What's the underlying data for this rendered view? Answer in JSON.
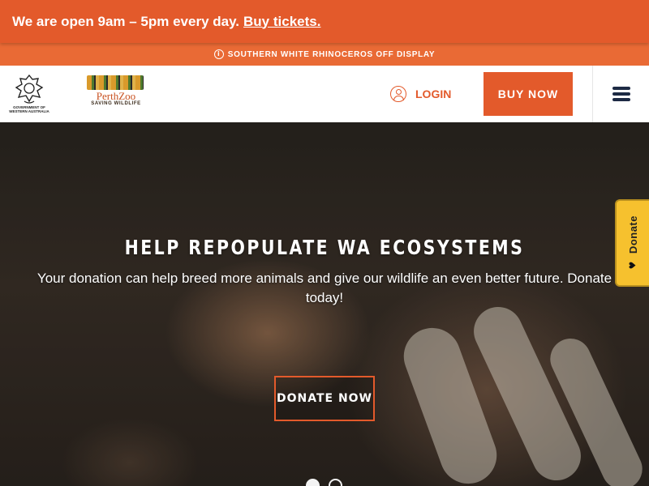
{
  "announcement": {
    "message": "We are open 9am – 5pm every day.",
    "link_text": "Buy tickets."
  },
  "alert": {
    "icon": "info-icon",
    "text": "SOUTHERN WHITE RHINOCEROS OFF DISPLAY"
  },
  "header": {
    "gov_logo_text": "GOVERNMENT OF WESTERN AUSTRALIA",
    "zoo_name": "PerthZoo",
    "zoo_tagline": "SAVING WILDLIFE",
    "login_label": "LOGIN",
    "buy_now_label": "BUY NOW",
    "menu_icon": "hamburger-menu-icon"
  },
  "hero": {
    "title": "HELP REPOPULATE WA ECOSYSTEMS",
    "subtitle": "Your donation can help breed more animals and give our wildlife an even better future. Donate today!",
    "button_label": "DONATE NOW",
    "slides": {
      "count": 2,
      "active_index": 0
    }
  },
  "donate_tab": {
    "label": "Donate",
    "icon": "heart-icon"
  },
  "colors": {
    "brand_orange": "#e35a2b",
    "alert_orange": "#e96a35",
    "navy": "#1d2a44",
    "donate_yellow": "#f6c12e"
  }
}
